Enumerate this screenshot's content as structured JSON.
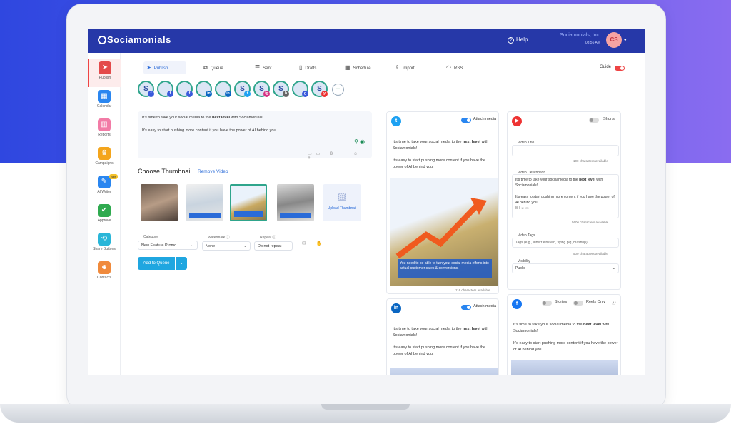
{
  "app": {
    "logo": "Sociamonials",
    "help": "Help",
    "company": "Sociamonials, Inc.",
    "time": "08:56 AM",
    "avatar_initials": "CS"
  },
  "sidebar": {
    "items": [
      {
        "label": "Publish",
        "icon": "paper-plane-icon",
        "color": "#e44b4b",
        "active": true
      },
      {
        "label": "Calendar",
        "icon": "calendar-icon",
        "color": "#2a86f0"
      },
      {
        "label": "Reports",
        "icon": "bar-chart-icon",
        "color": "#f27ba6"
      },
      {
        "label": "Campaigns",
        "icon": "trophy-icon",
        "color": "#f4a51c"
      },
      {
        "label": "AI Writer",
        "icon": "ai-icon",
        "color": "#2a86f0",
        "badge": "New"
      },
      {
        "label": "Approve",
        "icon": "approve-icon",
        "color": "#2faa4f"
      },
      {
        "label": "Share Buttons",
        "icon": "share-icon",
        "color": "#2ab6d8"
      },
      {
        "label": "Contacts",
        "icon": "contacts-icon",
        "color": "#f08a3c"
      }
    ]
  },
  "tabs": [
    {
      "label": "Publish",
      "icon": "send-icon",
      "active": true
    },
    {
      "label": "Queue",
      "icon": "queue-icon"
    },
    {
      "label": "Sent",
      "icon": "sent-icon"
    },
    {
      "label": "Drafts",
      "icon": "drafts-icon"
    },
    {
      "label": "Schedule",
      "icon": "schedule-icon"
    },
    {
      "label": "Import",
      "icon": "import-icon"
    },
    {
      "label": "RSS",
      "icon": "rss-icon"
    }
  ],
  "guide": "Guide",
  "accounts": [
    {
      "initial": "S",
      "net": "f",
      "netcolor": "#3b5bdb"
    },
    {
      "initial": "",
      "net": "f",
      "netcolor": "#3b5bdb"
    },
    {
      "initial": "",
      "net": "f",
      "netcolor": "#3b5bdb"
    },
    {
      "initial": "",
      "net": "in",
      "netcolor": "#0a66c2"
    },
    {
      "initial": "",
      "net": "in",
      "netcolor": "#0a66c2"
    },
    {
      "initial": "S",
      "net": "t",
      "netcolor": "#1da1f2"
    },
    {
      "initial": "S",
      "net": "ig",
      "netcolor": "#d63384"
    },
    {
      "initial": "S",
      "net": "b",
      "netcolor": "#666666"
    },
    {
      "initial": "",
      "net": "g",
      "netcolor": "#3b5bdb"
    },
    {
      "initial": "S",
      "net": "y",
      "netcolor": "#e33"
    }
  ],
  "composer": {
    "line1_pre": "It's time to take your social media to the ",
    "line1_bold": "next level",
    "line1_post": " with Sociamonials!",
    "line2": "It's easy to start pushing more content if you have the power of AI behind you."
  },
  "thumbnails": {
    "title": "Choose Thumbnail",
    "remove": "Remove Video",
    "upload": "Upload Thumbnail"
  },
  "fields": [
    {
      "label": "Category",
      "value": "New Feature Promo"
    },
    {
      "label": "Watermark",
      "value": "None"
    },
    {
      "label": "Repeat",
      "value": "Do not repeat"
    }
  ],
  "add_to_queue": "Add to Queue",
  "twitter": {
    "attach": "Attach media",
    "p1_pre": "It's time to take your social media to the ",
    "p1_bold": "next level",
    "p1_post": " with Sociamonials!",
    "p2": "It's easy to start pushing more content if you have the power of AI behind you.",
    "caption": "You need to be able to turn your social media efforts into actual customer sales & conversions.",
    "chars": "116 characters available"
  },
  "linkedin": {
    "attach": "Attach media",
    "p1_pre": "It's time to take your social media to the ",
    "p1_bold": "next level",
    "p1_post": " with Sociamonials!",
    "p2": "It's easy to start pushing more content if you have the power of AI behind you."
  },
  "youtube": {
    "shorts": "Shorts",
    "title_label": "Video Title",
    "title_chars": "100 characters available",
    "desc_label": "Video Description",
    "d1_pre": "It's time to take your social media to the ",
    "d1_bold": "next level",
    "d1_post": " with Sociamonials!",
    "d2": "It's easy to start pushing more content if you have the power of AI behind you.",
    "desc_chars": "5606 characters available",
    "tags_label": "Video Tags",
    "tags_placeholder": "Tags (e.g., albert einstein, flying pig, mashup)",
    "tags_chars": "500 characters available",
    "vis_label": "Visibility",
    "vis_value": "Public"
  },
  "facebook": {
    "stories": "Stories",
    "reels": "Reels Only",
    "p1_pre": "It's time to take your social media to the ",
    "p1_bold": "next level",
    "p1_post": " with Sociamonials!",
    "p2": "It's easy to start pushing more content if you have the power of AI behind you."
  }
}
